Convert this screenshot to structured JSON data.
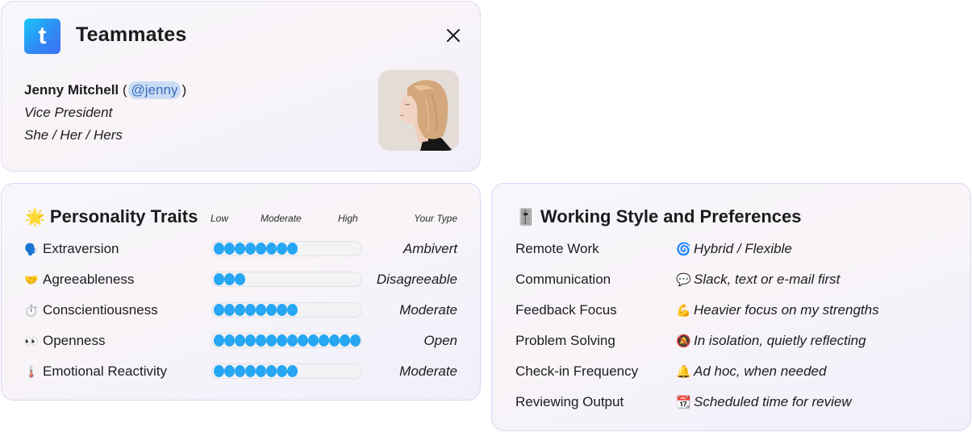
{
  "app": {
    "title": "Teammates",
    "logo_letter": "t",
    "close_icon": "close-icon"
  },
  "profile": {
    "name": "Jenny Mitchell",
    "paren_open": "(",
    "handle": "@jenny",
    "paren_close": ")",
    "role": "Vice President",
    "pronouns": "She / Her / Hers",
    "avatar_alt": "profile photo"
  },
  "personality": {
    "title": "Personality Traits",
    "title_emoji": "🌟",
    "scale": {
      "low": "Low",
      "moderate": "Moderate",
      "high": "High",
      "type_header": "Your Type"
    },
    "max_level": 14,
    "traits": [
      {
        "emoji": "🗣️",
        "label": "Extraversion",
        "level": 8,
        "type": "Ambivert"
      },
      {
        "emoji": "🤝",
        "label": "Agreeableness",
        "level": 3,
        "type": "Disagreeable"
      },
      {
        "emoji": "⏱️",
        "label": "Conscientiousness",
        "level": 8,
        "type": "Moderate"
      },
      {
        "emoji": "👀",
        "label": "Openness",
        "level": 14,
        "type": "Open"
      },
      {
        "emoji": "🌡️",
        "label": "Emotional Reactivity",
        "level": 8,
        "type": "Moderate"
      }
    ]
  },
  "working_style": {
    "title": "Working Style and Preferences",
    "title_emoji": "🎚️",
    "preferences": [
      {
        "label": "Remote Work",
        "emoji": "🌀",
        "value": "Hybrid / Flexible"
      },
      {
        "label": "Communication",
        "emoji": "💬",
        "value": "Slack, text or e-mail first"
      },
      {
        "label": "Feedback Focus",
        "emoji": "💪",
        "value": "Heavier focus on my strengths"
      },
      {
        "label": "Problem Solving",
        "emoji": "🔕",
        "value": "In isolation, quietly reflecting"
      },
      {
        "label": "Check-in Frequency",
        "emoji": "🔔",
        "value": "Ad hoc, when needed"
      },
      {
        "label": "Reviewing Output",
        "emoji": "📆",
        "value": "Scheduled time for review"
      }
    ]
  },
  "colors": {
    "accent_dot": "#26a6f3",
    "mention_bg": "#c9dcf3",
    "mention_text": "#3a6cc0",
    "card_border": "#dcd6f4"
  }
}
